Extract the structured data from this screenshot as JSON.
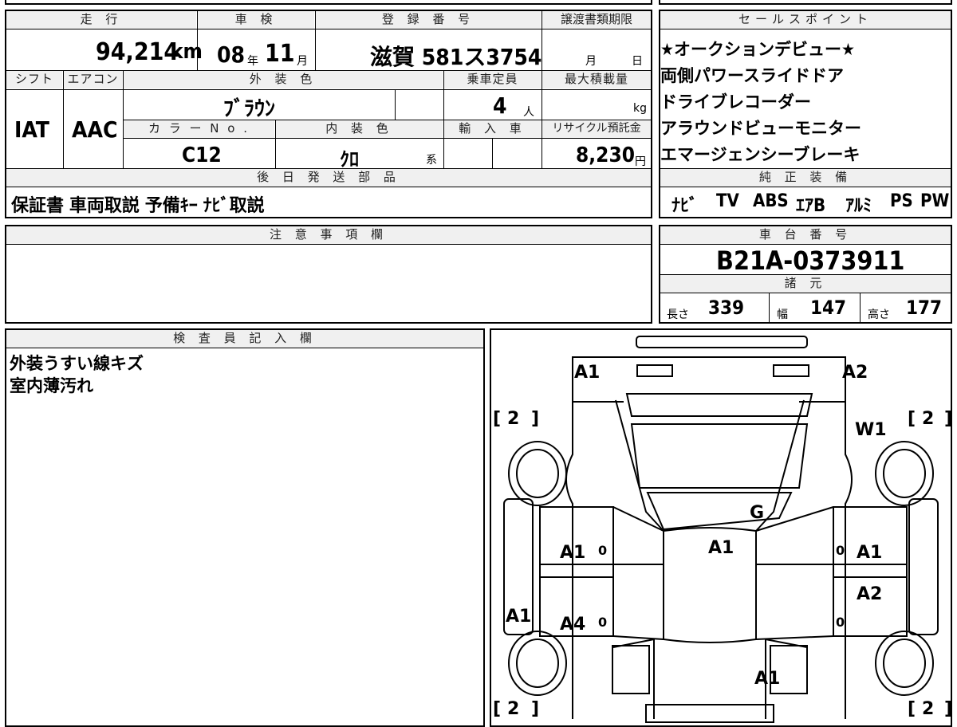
{
  "main": {
    "mileage_label": "走 行",
    "mileage_value": "94,214",
    "mileage_unit": "km",
    "inspection_label": "車 検",
    "inspection_year": "08",
    "inspection_year_unit": "年",
    "inspection_month": "11",
    "inspection_month_unit": "月",
    "registration_label": "登 録 番 号",
    "registration_value": "滋賀 581ス3754",
    "transfer_label": "譲渡書類期限",
    "transfer_month": "月",
    "transfer_day": "日",
    "shift_label": "シフト",
    "shift_value": "IAT",
    "ac_label": "エアコン",
    "ac_value": "AAC",
    "exterior_label": "外 装 色",
    "exterior_value": "ﾌﾞﾗｳﾝ",
    "capacity_label": "乗車定員",
    "capacity_value": "4",
    "capacity_unit": "人",
    "load_label": "最大積載量",
    "load_unit": "kg",
    "color_no_label": "カ ラ ー N o .",
    "color_no_value": "C12",
    "interior_label": "内 装 色",
    "interior_value": "ｸﾛ",
    "interior_unit": "系",
    "import_label": "輸 入 車",
    "recycle_label": "リサイクル預託金",
    "recycle_value": "8,230",
    "recycle_unit": "円",
    "later_parts_label": "後 日 発 送 部 品",
    "later_parts_value": "保証書  車両取説  予備ｷｰ  ﾅﾋﾞ取説"
  },
  "sales": {
    "label": "セールスポイント",
    "points": [
      "★オークションデビュー★",
      "両側パワースライドドア",
      "ドライブレコーダー",
      "アラウンドビューモニター",
      "エマージェンシーブレーキ"
    ],
    "equipment_label": "純 正 装 備",
    "equipment": [
      "ﾅﾋﾞ",
      "TV",
      "ABS",
      "ｴｱB",
      "ｱﾙﾐ",
      "PS",
      "PW"
    ]
  },
  "notes": {
    "label": "注 意 事 項 欄",
    "value": ""
  },
  "chassis": {
    "label": "車 台 番 号",
    "value": "B21A-0373911",
    "spec_label": "諸 元",
    "length_label": "長さ",
    "length_value": "339",
    "width_label": "幅",
    "width_value": "147",
    "height_label": "高さ",
    "height_value": "177"
  },
  "inspector": {
    "label": "検 査 員 記 入 欄",
    "lines": [
      "外装うすい線キズ",
      "室内薄汚れ"
    ]
  },
  "diagram": {
    "marks": {
      "front_left": "A1",
      "front_right": "A2",
      "windshield": "W1",
      "roof_glass": "G",
      "roof": "A1",
      "left_front_door": "A1",
      "left_rear_door": "A4",
      "left_side": "A1",
      "right_front_door": "A1",
      "right_rear_door": "A2",
      "rear": "A1",
      "tire_fl": "2",
      "tire_fr": "2",
      "tire_rl": "2",
      "tire_rr": "2",
      "door_zero_1": "0",
      "door_zero_2": "0",
      "door_zero_3": "0",
      "door_zero_4": "0"
    }
  }
}
